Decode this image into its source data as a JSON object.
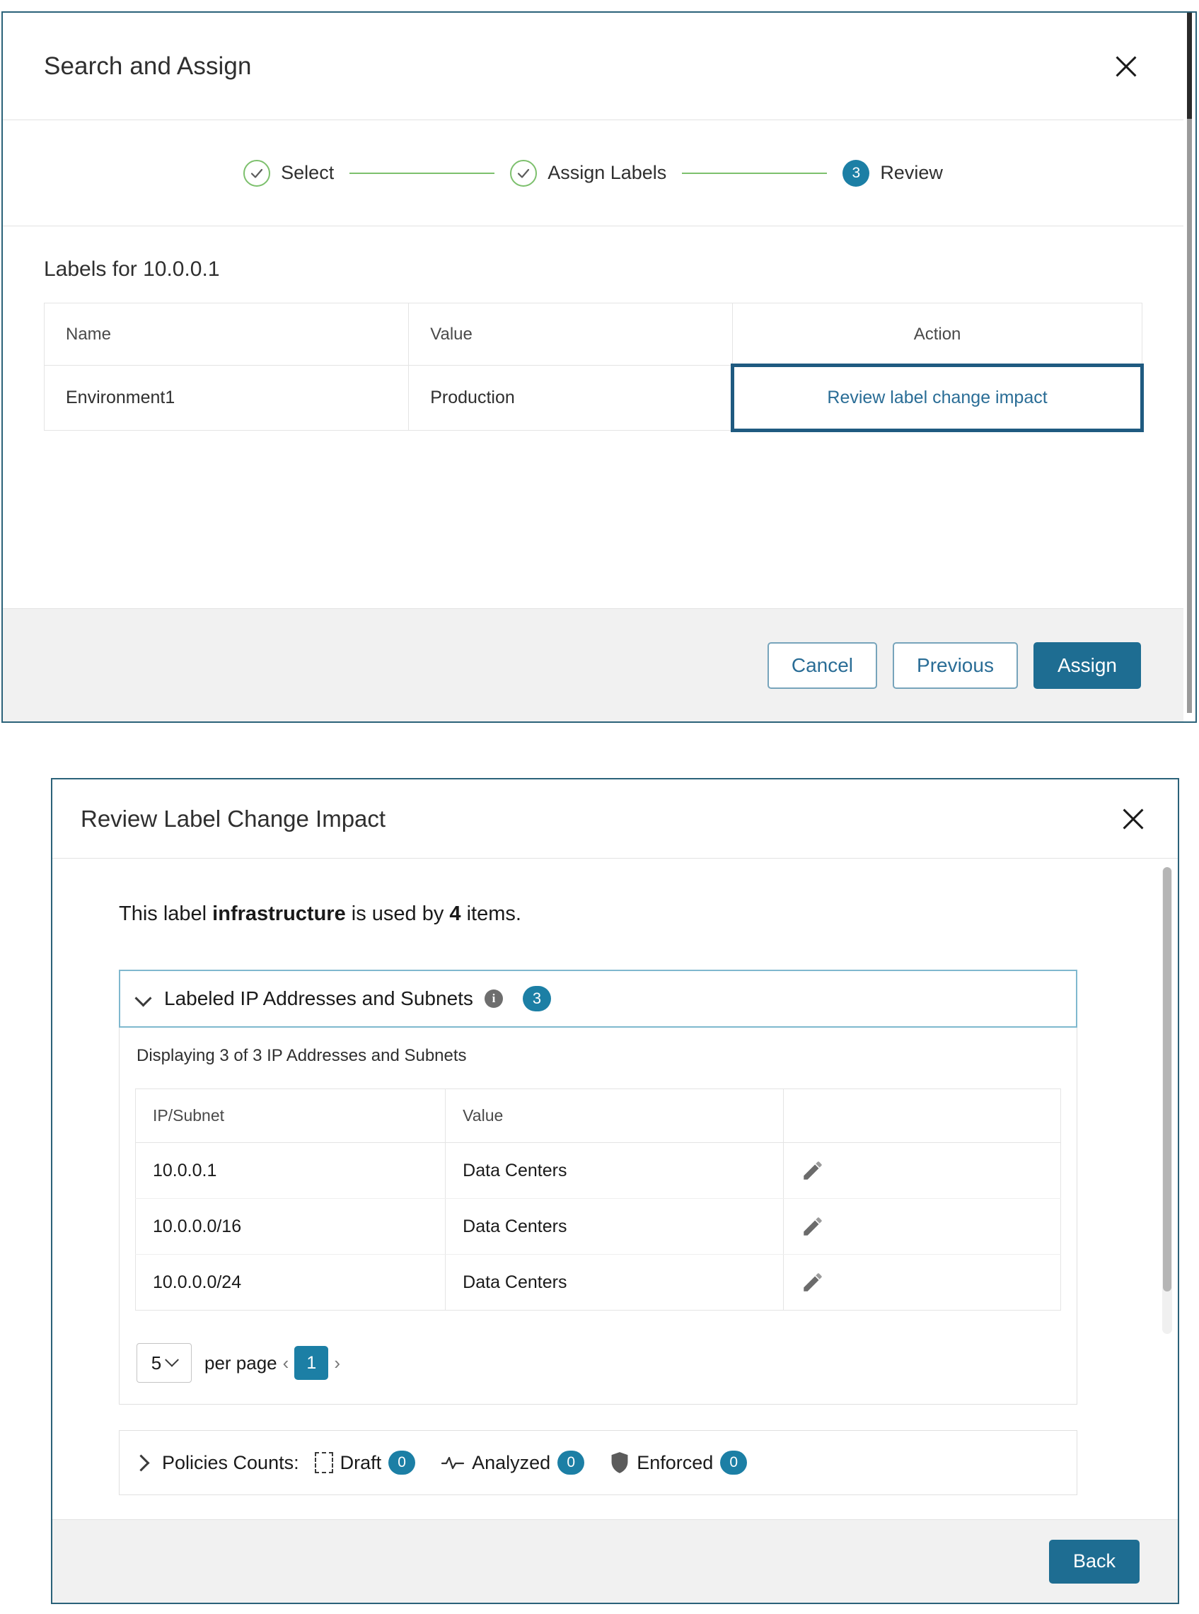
{
  "dialog1": {
    "title": "Search and Assign",
    "close_label": "×",
    "stepper": {
      "steps": [
        {
          "label": "Select",
          "state": "done",
          "marker": "check"
        },
        {
          "label": "Assign Labels",
          "state": "done",
          "marker": "check"
        },
        {
          "label": "Review",
          "state": "active",
          "marker": "3"
        }
      ]
    },
    "section_title": "Labels for 10.0.0.1",
    "table": {
      "columns": [
        "Name",
        "Value",
        "Action"
      ],
      "rows": [
        {
          "name": "Environment1",
          "value": "Production",
          "action": "Review label change impact"
        }
      ]
    },
    "footer": {
      "cancel": "Cancel",
      "previous": "Previous",
      "assign": "Assign"
    }
  },
  "dialog2": {
    "title": "Review Label Change Impact",
    "close_label": "×",
    "impact": {
      "prefix": "This label ",
      "label_name": "infrastructure",
      "middle": " is used by ",
      "count": "4",
      "suffix": " items."
    },
    "accordion": {
      "title": "Labeled IP Addresses and Subnets",
      "info_icon_label": "i",
      "count_badge": "3",
      "expanded": true,
      "displaying": "Displaying 3 of 3 IP Addresses and Subnets",
      "table": {
        "columns": [
          "IP/Subnet",
          "Value",
          ""
        ],
        "rows": [
          {
            "ip": "10.0.0.1",
            "value": "Data Centers",
            "action_icon": "pencil-icon"
          },
          {
            "ip": "10.0.0.0/16",
            "value": "Data Centers",
            "action_icon": "pencil-icon"
          },
          {
            "ip": "10.0.0.0/24",
            "value": "Data Centers",
            "action_icon": "pencil-icon"
          }
        ]
      },
      "pagination": {
        "per_page_value": "5",
        "per_page_label": "per page",
        "prev_arrow": "‹",
        "current_page": "1",
        "next_arrow": "›"
      }
    },
    "policies": {
      "label": "Policies Counts:",
      "expanded": false,
      "items": [
        {
          "name": "Draft",
          "count": "0",
          "icon": "draft-square-icon"
        },
        {
          "name": "Analyzed",
          "count": "0",
          "icon": "waveform-icon"
        },
        {
          "name": "Enforced",
          "count": "0",
          "icon": "shield-icon"
        }
      ]
    },
    "footer": {
      "back": "Back"
    }
  },
  "colors": {
    "accent_blue": "#1c7fa5",
    "primary_button": "#1e6d92",
    "link_blue": "#2a6d96",
    "step_done_green": "#7dc06d",
    "highlight_border": "#1f5a80",
    "dialog_border": "#2b6279"
  }
}
